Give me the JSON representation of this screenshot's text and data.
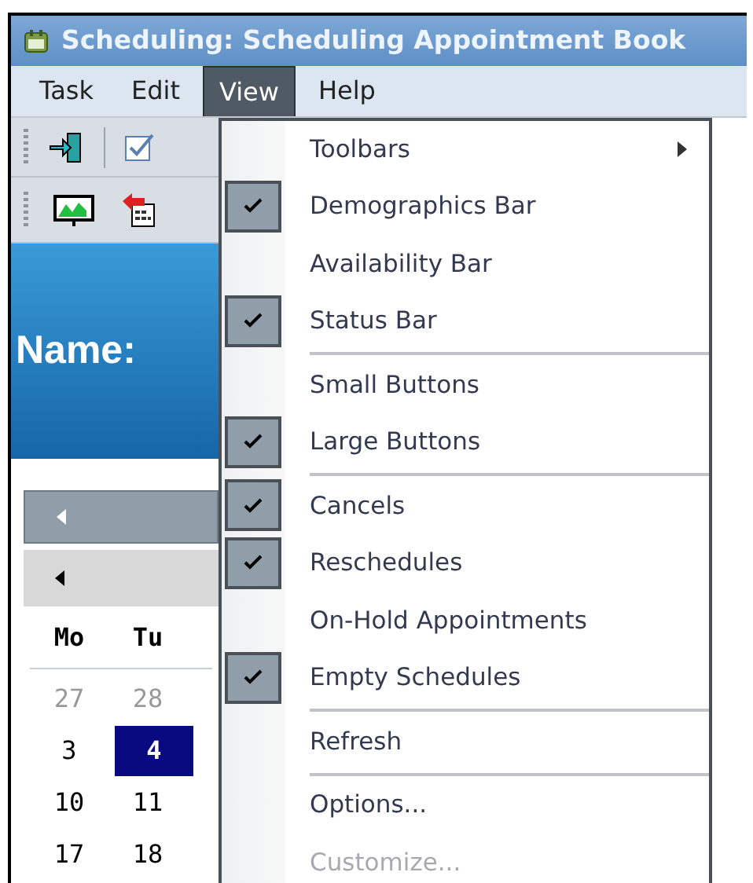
{
  "window": {
    "title": "Scheduling: Scheduling Appointment Book"
  },
  "menu_bar": [
    {
      "label": "Task",
      "selected": false
    },
    {
      "label": "Edit",
      "selected": false
    },
    {
      "label": "View",
      "selected": true
    },
    {
      "label": "Help",
      "selected": false
    }
  ],
  "banner": {
    "label": "Name:"
  },
  "calendar": {
    "day_headers": [
      "Mo",
      "Tu"
    ],
    "weeks": [
      [
        {
          "day": "27",
          "other_month": true,
          "selected": false
        },
        {
          "day": "28",
          "other_month": true,
          "selected": false
        }
      ],
      [
        {
          "day": "3",
          "other_month": false,
          "selected": false
        },
        {
          "day": "4",
          "other_month": false,
          "selected": true
        }
      ],
      [
        {
          "day": "10",
          "other_month": false,
          "selected": false
        },
        {
          "day": "11",
          "other_month": false,
          "selected": false
        }
      ],
      [
        {
          "day": "17",
          "other_month": false,
          "selected": false
        },
        {
          "day": "18",
          "other_month": false,
          "selected": false
        }
      ]
    ]
  },
  "view_menu": [
    {
      "kind": "item",
      "label": "Toolbars",
      "checked": false,
      "submenu": true,
      "disabled": false
    },
    {
      "kind": "item",
      "label": "Demographics Bar",
      "checked": true,
      "submenu": false,
      "disabled": false
    },
    {
      "kind": "item",
      "label": "Availability Bar",
      "checked": false,
      "submenu": false,
      "disabled": false
    },
    {
      "kind": "item",
      "label": "Status Bar",
      "checked": true,
      "submenu": false,
      "disabled": false
    },
    {
      "kind": "separator"
    },
    {
      "kind": "item",
      "label": "Small Buttons",
      "checked": false,
      "submenu": false,
      "disabled": false
    },
    {
      "kind": "item",
      "label": "Large Buttons",
      "checked": true,
      "submenu": false,
      "disabled": false
    },
    {
      "kind": "separator"
    },
    {
      "kind": "item",
      "label": "Cancels",
      "checked": true,
      "submenu": false,
      "disabled": false
    },
    {
      "kind": "item",
      "label": "Reschedules",
      "checked": true,
      "submenu": false,
      "disabled": false
    },
    {
      "kind": "item",
      "label": "On-Hold Appointments",
      "checked": false,
      "submenu": false,
      "disabled": false
    },
    {
      "kind": "item",
      "label": "Empty Schedules",
      "checked": true,
      "submenu": false,
      "disabled": false
    },
    {
      "kind": "separator"
    },
    {
      "kind": "item",
      "label": "Refresh",
      "checked": false,
      "submenu": false,
      "disabled": false
    },
    {
      "kind": "separator"
    },
    {
      "kind": "item",
      "label": "Options...",
      "checked": false,
      "submenu": false,
      "disabled": false
    },
    {
      "kind": "item",
      "label": "Customize...",
      "checked": false,
      "submenu": false,
      "disabled": true
    }
  ]
}
